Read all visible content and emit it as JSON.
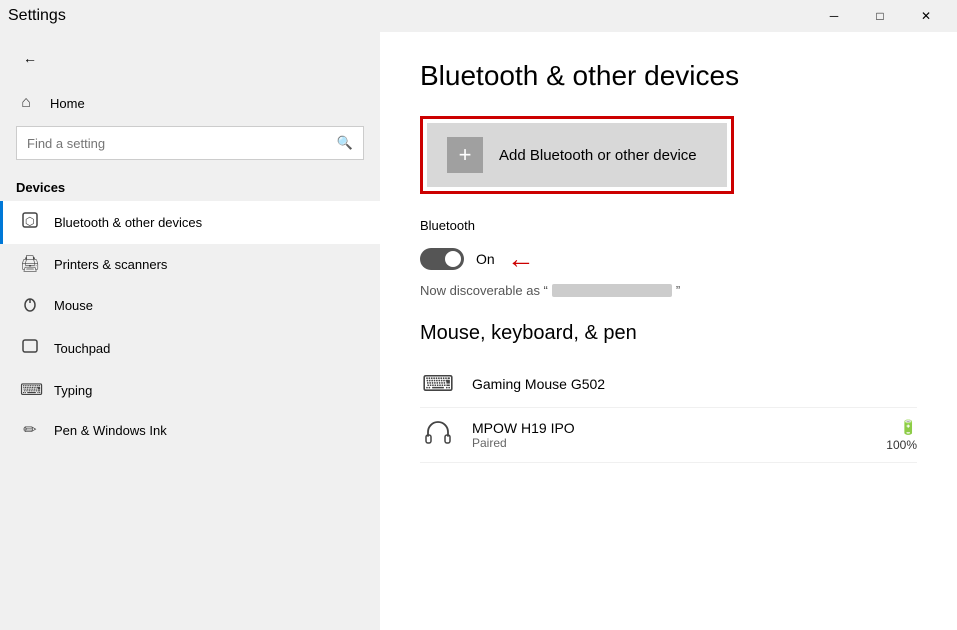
{
  "titlebar": {
    "title": "Settings",
    "back_label": "←",
    "min_label": "─",
    "max_label": "□",
    "close_label": "✕"
  },
  "sidebar": {
    "home_label": "Home",
    "search_placeholder": "Find a setting",
    "section_label": "Devices",
    "items": [
      {
        "id": "bluetooth",
        "label": "Bluetooth & other devices",
        "active": true
      },
      {
        "id": "printers",
        "label": "Printers & scanners",
        "active": false
      },
      {
        "id": "mouse",
        "label": "Mouse",
        "active": false
      },
      {
        "id": "touchpad",
        "label": "Touchpad",
        "active": false
      },
      {
        "id": "typing",
        "label": "Typing",
        "active": false
      },
      {
        "id": "pen",
        "label": "Pen & Windows Ink",
        "active": false
      }
    ]
  },
  "content": {
    "page_title": "Bluetooth & other devices",
    "add_device_label": "Add Bluetooth or other device",
    "bluetooth_section": "Bluetooth",
    "toggle_state": "On",
    "discoverable_prefix": "Now discoverable as “",
    "discoverable_suffix": "”",
    "mouse_keyboard_section": "Mouse, keyboard, & pen",
    "devices": [
      {
        "name": "Gaming Mouse G502",
        "status": "",
        "show_battery": false
      },
      {
        "name": "MPOW H19 IPO",
        "status": "Paired",
        "show_battery": true,
        "battery_pct": "100%"
      }
    ]
  }
}
